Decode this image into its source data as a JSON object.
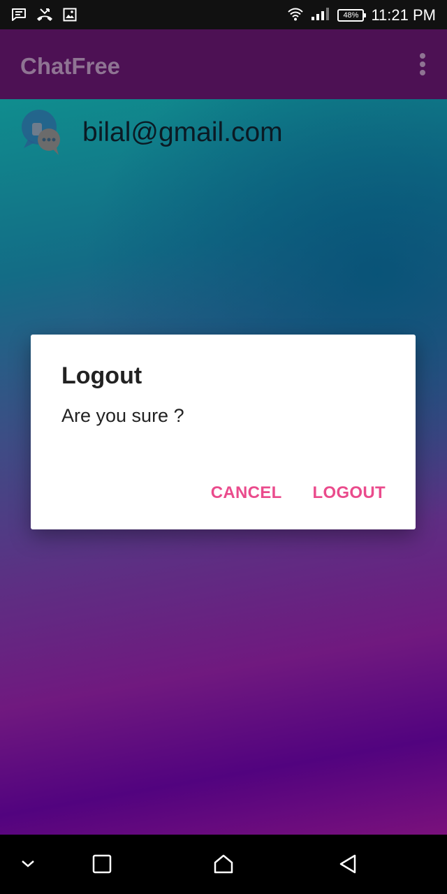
{
  "status_bar": {
    "time": "11:21 PM",
    "battery": "48%",
    "icons": [
      "message-notification-icon",
      "missed-call-icon",
      "image-notification-icon",
      "wifi-icon",
      "signal-icon",
      "battery-icon"
    ]
  },
  "app_bar": {
    "title": "ChatFree",
    "menu_icon": "overflow-menu-icon"
  },
  "contact": {
    "email": "bilal@gmail.com",
    "avatar_icon": "chat-avatar-icon"
  },
  "dialog": {
    "title": "Logout",
    "message": "Are you sure ?",
    "cancel_label": "CANCEL",
    "confirm_label": "LOGOUT"
  },
  "nav_bar": {
    "icons": [
      "collapse-chevron-icon",
      "recents-icon",
      "home-icon",
      "back-icon"
    ]
  },
  "colors": {
    "app_bar": "#4d1154",
    "dialog_accent": "#ea4b8c",
    "status_bar": "#111111",
    "nav_bar": "#000000"
  }
}
